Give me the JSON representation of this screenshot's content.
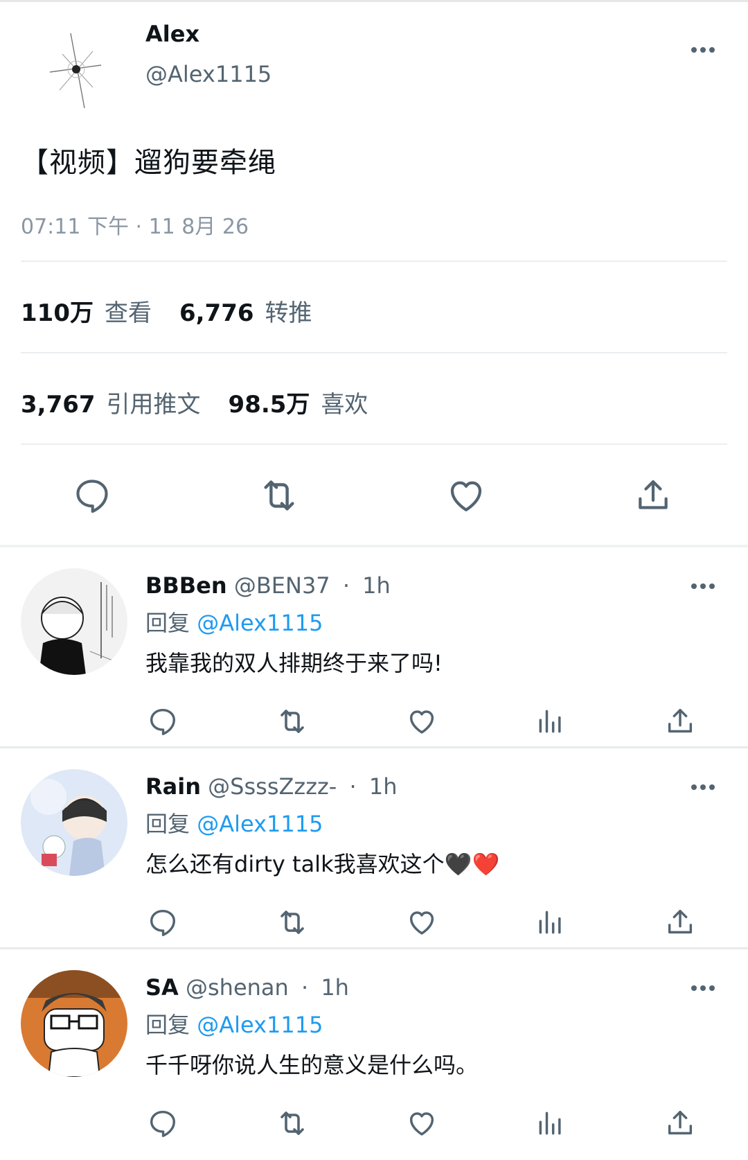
{
  "main_tweet": {
    "author_name": "Alex",
    "author_handle": "@Alex1115",
    "text": "【视频】遛狗要牵绳",
    "timestamp": "07:11 下午 · 11 8月 26",
    "stats": {
      "views_value": "110万",
      "views_label": "查看",
      "retweets_value": "6,776",
      "retweets_label": "转推",
      "quotes_value": "3,767",
      "quotes_label": "引用推文",
      "likes_value": "98.5万",
      "likes_label": "喜欢"
    },
    "actions": [
      "reply-icon",
      "retweet-icon",
      "like-icon",
      "share-icon"
    ]
  },
  "replies": [
    {
      "name": "BBBen",
      "handle": "@BEN37",
      "time": "1h",
      "reply_prefix": "回复",
      "reply_to": "@Alex1115",
      "text": "我靠我的双人排期终于来了吗!"
    },
    {
      "name": "Rain",
      "handle": "@SsssZzzz-",
      "time": "1h",
      "reply_prefix": "回复",
      "reply_to": "@Alex1115",
      "text": "怎么还有dirty talk我喜欢这个",
      "emojis": "🖤❤️"
    },
    {
      "name": "SA",
      "handle": "@shenan",
      "time": "1h",
      "reply_prefix": "回复",
      "reply_to": "@Alex1115",
      "text": "千千呀你说人生的意义是什么吗。"
    }
  ],
  "icons": {
    "more": "more-dots-icon",
    "reply": "reply-icon",
    "retweet": "retweet-icon",
    "like": "heart-icon",
    "views": "analytics-icon",
    "share": "share-icon"
  },
  "colors": {
    "text": "#0f1419",
    "muted": "#536471",
    "link": "#1d9bf0",
    "divider": "#ebeef0"
  }
}
